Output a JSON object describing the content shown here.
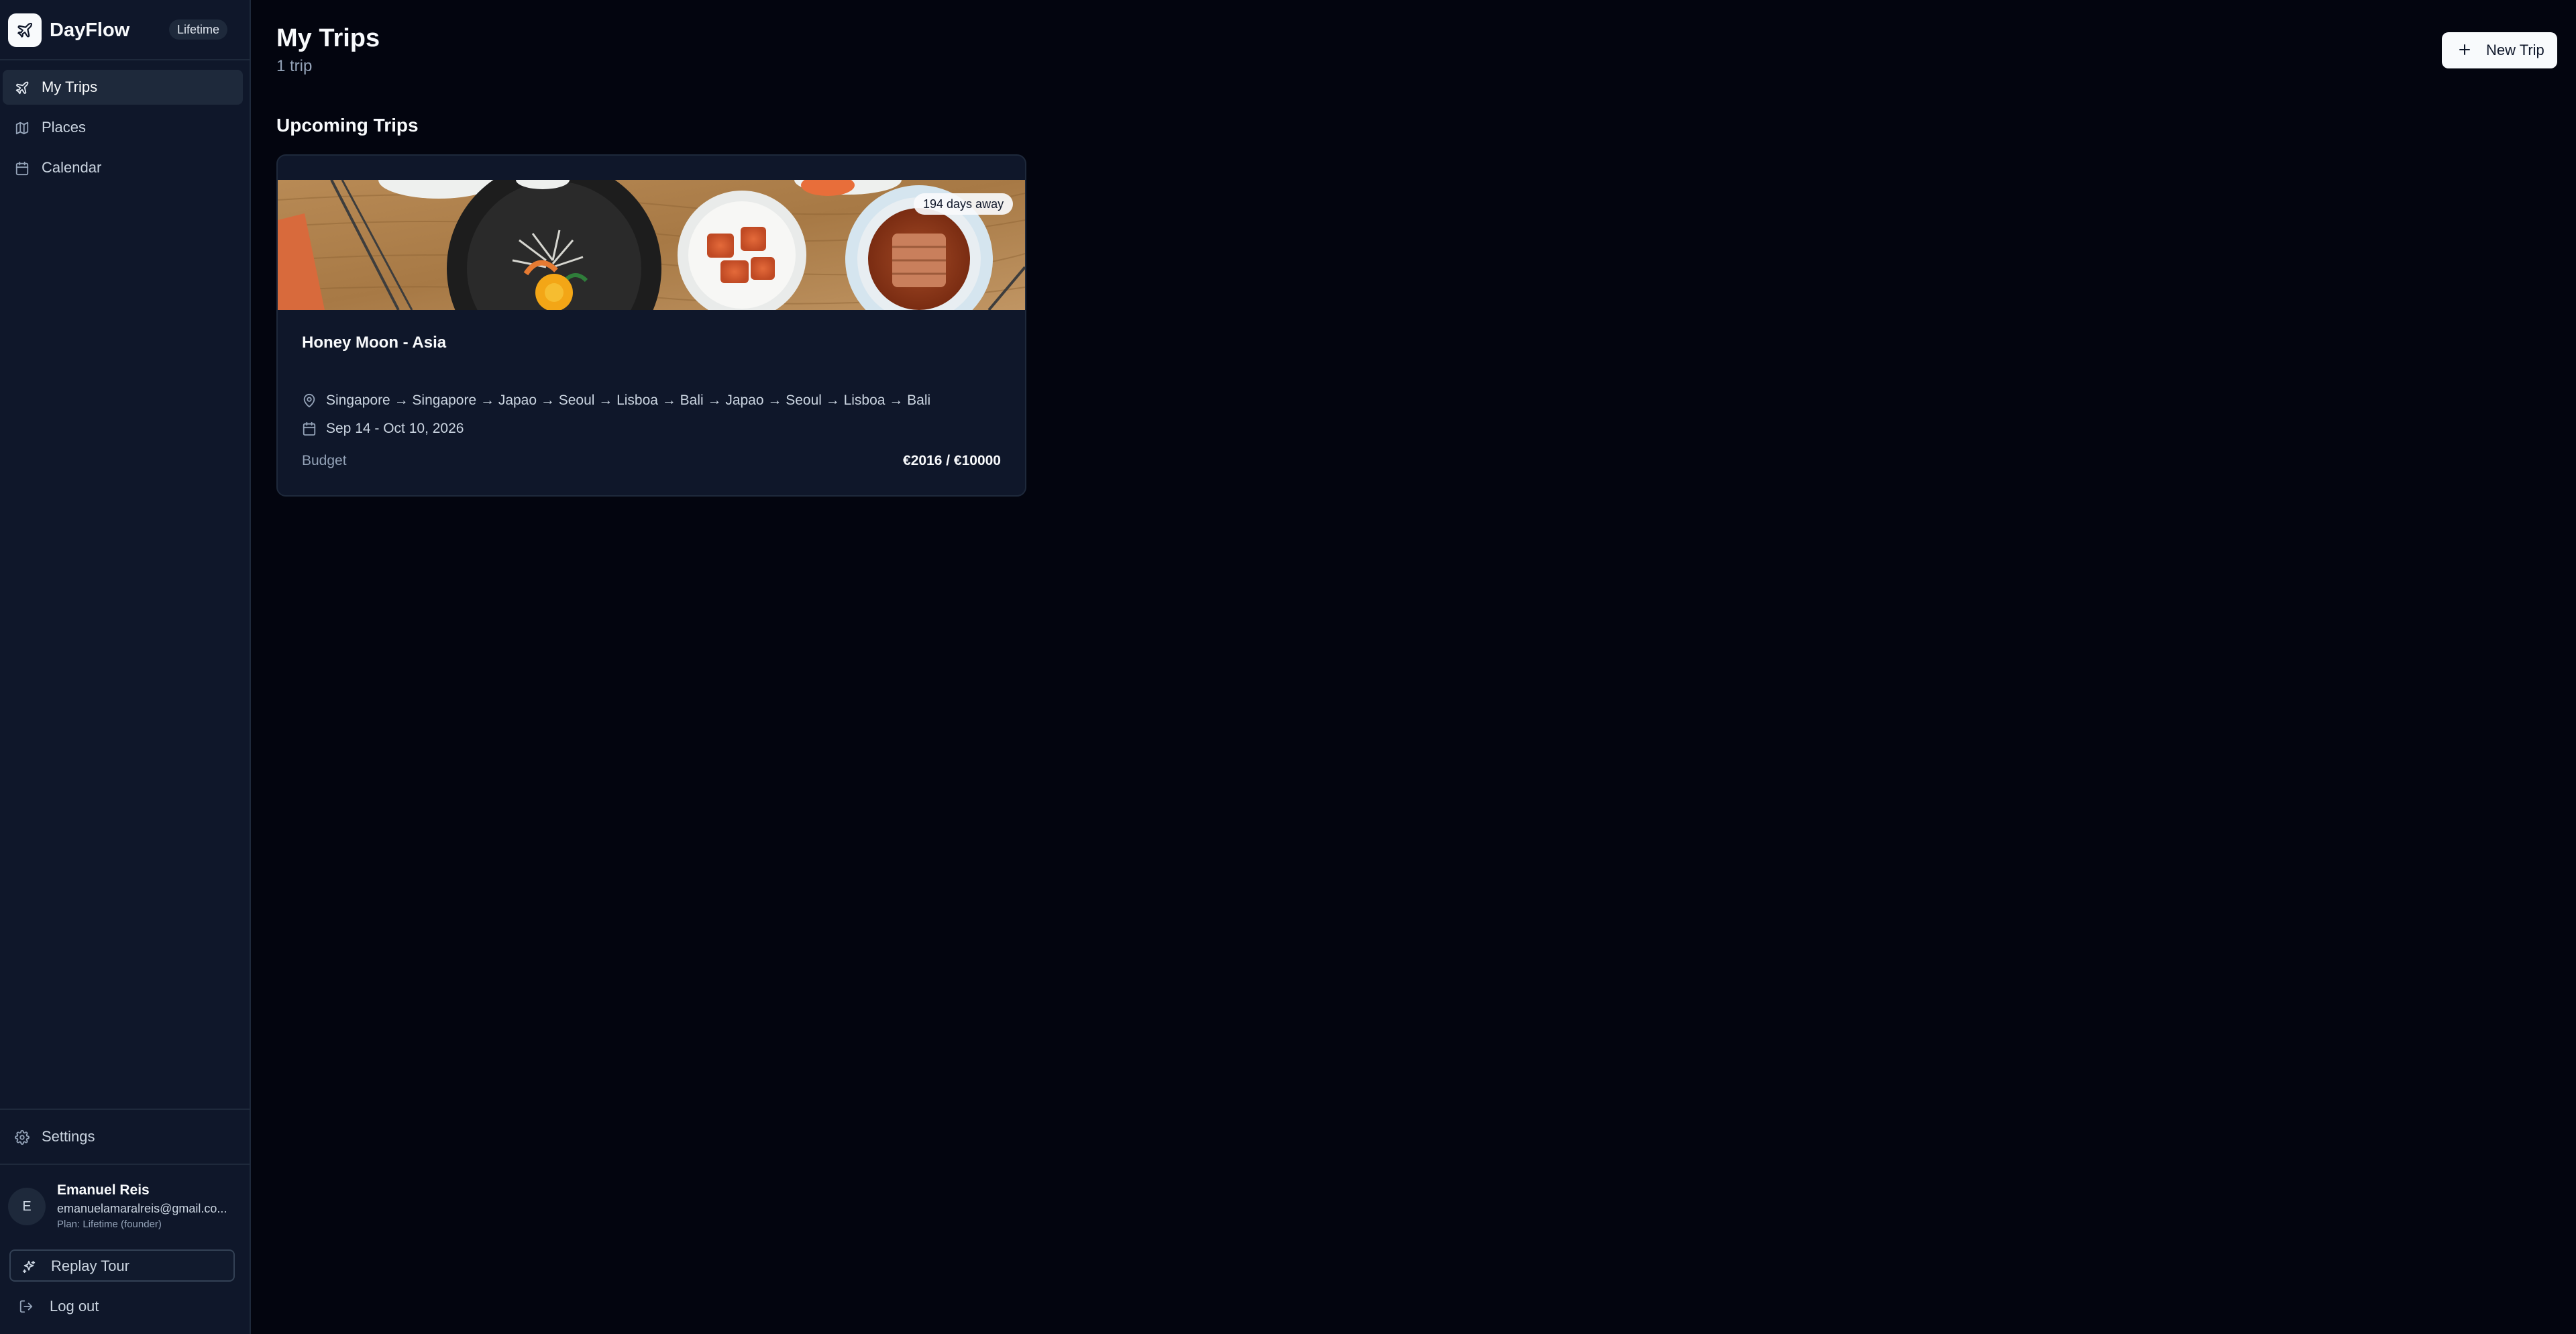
{
  "app": {
    "name": "DayFlow",
    "plan_badge": "Lifetime"
  },
  "sidebar": {
    "items": [
      {
        "label": "My Trips",
        "icon": "plane-icon",
        "active": true
      },
      {
        "label": "Places",
        "icon": "map-icon",
        "active": false
      },
      {
        "label": "Calendar",
        "icon": "calendar-icon",
        "active": false
      }
    ],
    "settings_label": "Settings",
    "user": {
      "initial": "E",
      "name": "Emanuel Reis",
      "email": "emanuelamaralreis@gmail.co...",
      "plan": "Plan: Lifetime (founder)"
    },
    "replay_tour_label": "Replay Tour",
    "logout_label": "Log out"
  },
  "header": {
    "title": "My Trips",
    "subtitle": "1 trip",
    "new_trip_label": "New Trip"
  },
  "section": {
    "title": "Upcoming Trips"
  },
  "trips": [
    {
      "badge": "194 days away",
      "name": "Honey Moon - Asia",
      "route": "Singapore → Singapore → Japao → Seoul → Lisboa → Bali → Japao → Seoul → Lisboa → Bali",
      "dates": "Sep 14 - Oct 10, 2026",
      "budget_label": "Budget",
      "budget_value": "€2016 / €10000"
    }
  ],
  "colors": {
    "background": "#03050f",
    "sidebar": "#0f172a",
    "card": "#0f172a",
    "border": "#1e293b",
    "primary_button": "#f8fafc"
  }
}
